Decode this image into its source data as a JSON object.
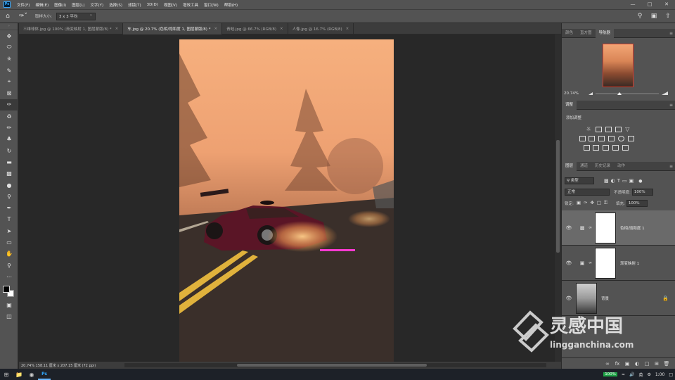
{
  "menubar": {
    "app_logo": "Ps",
    "items": [
      "文件(F)",
      "编辑(E)",
      "图像(I)",
      "图层(L)",
      "文字(Y)",
      "选择(S)",
      "滤镜(T)",
      "3D(D)",
      "视图(V)",
      "增效工具",
      "窗口(W)",
      "帮助(H)"
    ]
  },
  "options": {
    "sample_size_label": "取样大小:",
    "sample_size_value": "3 x 3 平均"
  },
  "tabs": [
    {
      "label": "三维球体.jpg @ 100% (渐变映射 1, 图层蒙版/8) *",
      "active": false
    },
    {
      "label": "车.jpg @ 20.7% (色相/饱和度 1, 图层蒙版/8) *",
      "active": true
    },
    {
      "label": "青蛙.jpg @ 66.7% (RGB/8)",
      "active": false
    },
    {
      "label": "人像.jpg @ 16.7% (RGB/8)",
      "active": false
    }
  ],
  "status": {
    "text": "20.74%   158.11 厘米 x 207.15 厘米 (72 ppi)"
  },
  "navigator": {
    "tabs": [
      "颜色",
      "直方图",
      "导航器"
    ],
    "active_tab": "导航器",
    "zoom": "20.74%"
  },
  "adjustments": {
    "tab": "调整",
    "add_label": "添加调整"
  },
  "layers": {
    "tabs": [
      "图层",
      "通道",
      "历史记录",
      "动作"
    ],
    "active_tab": "图层",
    "filter_kind": "类型",
    "blend_mode": "正常",
    "opacity_label": "不透明度:",
    "opacity_value": "100%",
    "lock_label": "锁定:",
    "fill_label": "填充:",
    "fill_value": "100%",
    "items": [
      {
        "name": "色相/饱和度 1",
        "type": "adjustment",
        "selected": true
      },
      {
        "name": "渐变映射 1",
        "type": "adjustment",
        "selected": false
      },
      {
        "name": "背景",
        "type": "image",
        "selected": false,
        "locked": true
      }
    ]
  },
  "watermark": {
    "brand_cn": "灵感中国",
    "brand_url": "lingganchina.com"
  },
  "taskbar": {
    "battery": "100%",
    "ime": "英",
    "time": "1:00"
  },
  "colors": {
    "accent": "#31a8ff",
    "thumb_border": "#d63b2a",
    "ui_bg": "#535353",
    "canvas_bg": "#282828"
  }
}
